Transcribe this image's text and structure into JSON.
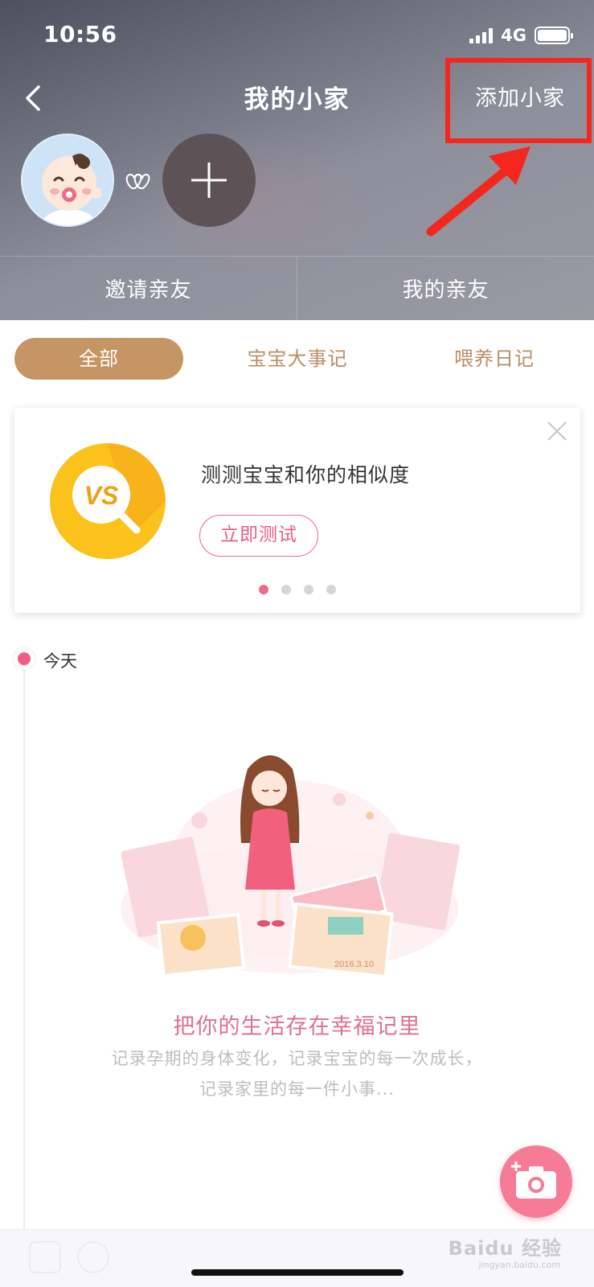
{
  "status_bar": {
    "time": "10:56",
    "network": "4G"
  },
  "nav": {
    "title": "我的小家",
    "add_home_label": "添加小家"
  },
  "header_tabs": [
    {
      "label": "邀请亲友"
    },
    {
      "label": "我的亲友"
    }
  ],
  "filter_tabs": [
    {
      "label": "全部",
      "active": true
    },
    {
      "label": "宝宝大事记",
      "active": false
    },
    {
      "label": "喂养日记",
      "active": false
    }
  ],
  "promo": {
    "title": "测测宝宝和你的相似度",
    "button_label": "立即测试",
    "icon_text": "VS",
    "slide_count": 4,
    "active_slide": 1
  },
  "timeline": {
    "label": "今天"
  },
  "empty_state": {
    "title": "把你的生活存在幸福记里",
    "description_line1": "记录孕期的身体变化，记录宝宝的每一次成长，",
    "description_line2": "记录家里的每一件小事..."
  },
  "illustration": {
    "photo_caption_1": "2016.3.10"
  },
  "watermark": {
    "text": "Baidu 经验",
    "sub": "jingyan.baidu.com"
  },
  "colors": {
    "accent_brown": "#c69564",
    "accent_pink": "#f45b83",
    "highlight_red": "#f3271d"
  }
}
